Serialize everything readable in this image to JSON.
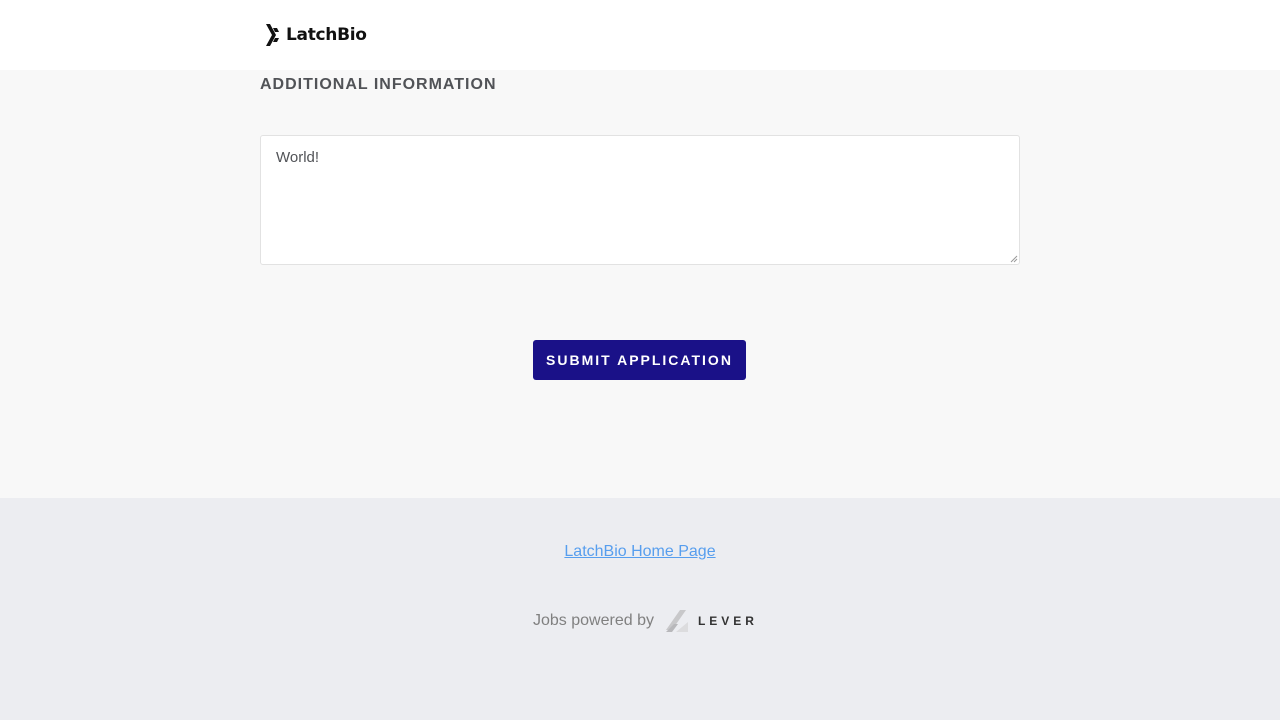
{
  "header": {
    "logo_text": "LatchBio",
    "logo_icon": "latchbio-logo-icon"
  },
  "form": {
    "section_title": "ADDITIONAL INFORMATION",
    "additional_info_value": "World!",
    "submit_label": "SUBMIT APPLICATION"
  },
  "footer": {
    "home_link_label": "LatchBio Home Page",
    "powered_by_label": "Jobs powered by",
    "lever_label": "LEVER",
    "lever_icon": "lever-logo-icon"
  },
  "colors": {
    "submit_button": "#1a1188",
    "link": "#579eee",
    "footer_bg": "#ecedf1",
    "main_bg": "#f8f8f8"
  }
}
